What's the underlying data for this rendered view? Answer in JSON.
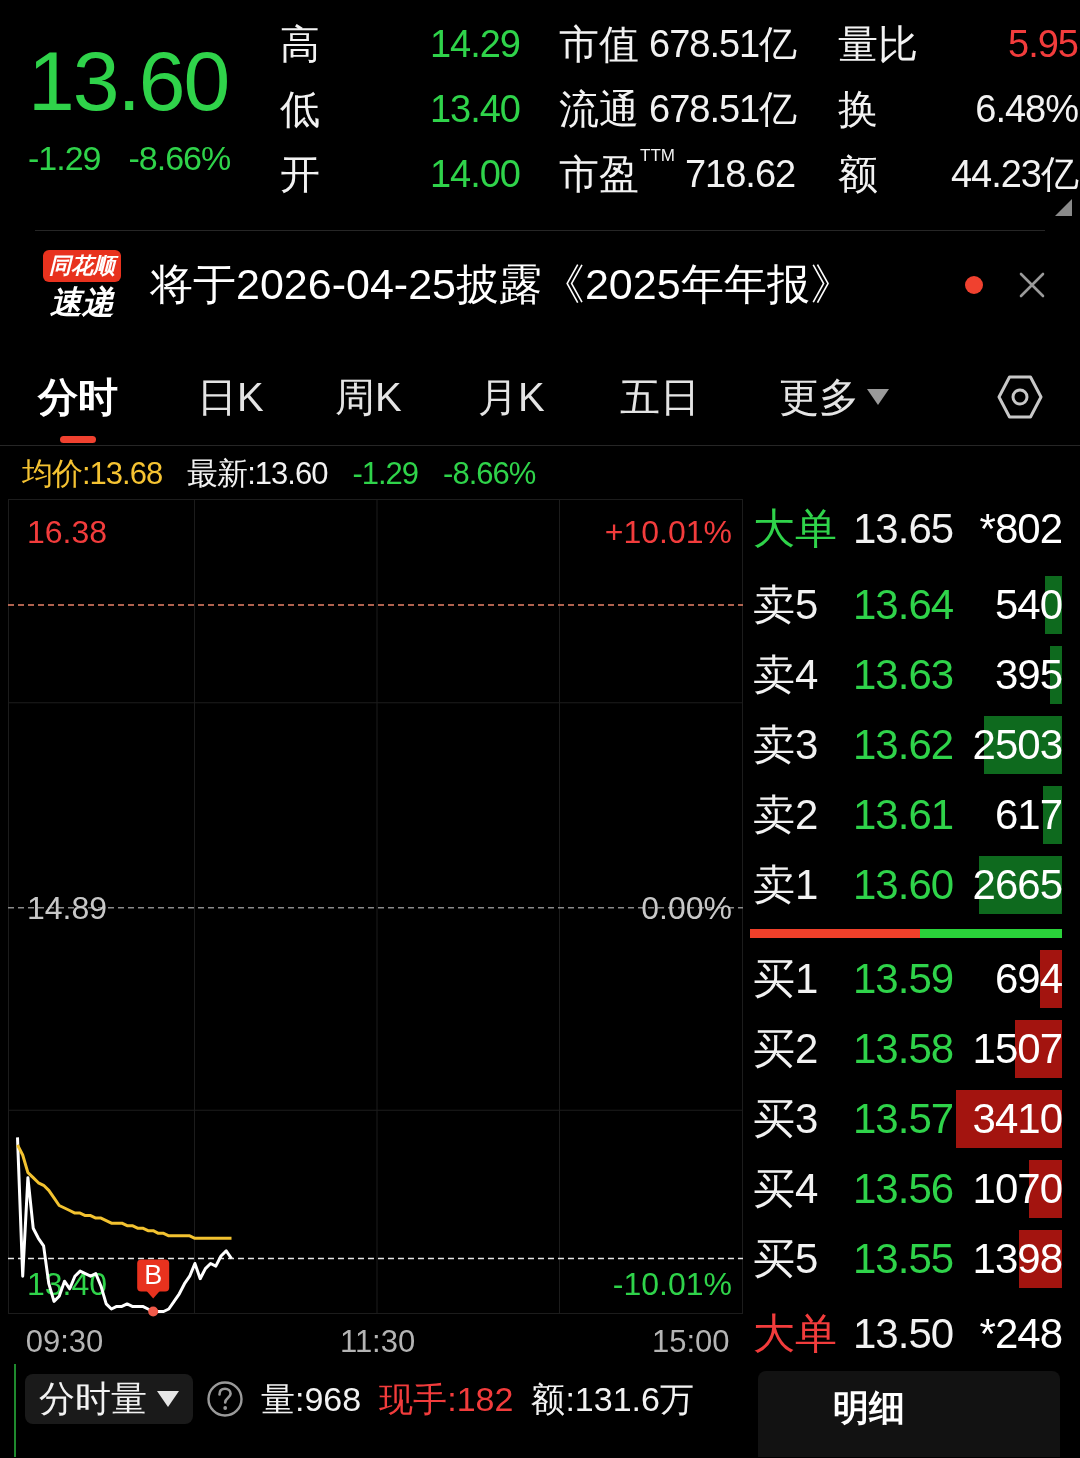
{
  "quote": {
    "price": "13.60",
    "change": "-1.29",
    "change_pct": "-8.66%",
    "stats": [
      [
        {
          "label": "高",
          "value": "14.29",
          "color": "#2fd34a"
        },
        {
          "label": "低",
          "value": "13.40",
          "color": "#2fd34a"
        },
        {
          "label": "开",
          "value": "14.00",
          "color": "#2fd34a"
        }
      ],
      [
        {
          "label": "市值",
          "value": "678.51亿",
          "color": "#f2f2f2"
        },
        {
          "label": "流通",
          "value": "678.51亿",
          "color": "#f2f2f2"
        },
        {
          "label": "市盈$^{TTM}$",
          "value": "718.62",
          "color": "#f2f2f2"
        }
      ],
      [
        {
          "label": "量比",
          "value": "5.95",
          "color": "#f23c3c"
        },
        {
          "label": "换",
          "value": "6.48%",
          "color": "#f2f2f2"
        },
        {
          "label": "额",
          "value": "44.23亿",
          "color": "#f2f2f2"
        }
      ]
    ]
  },
  "news": {
    "logo_top": "同花顺",
    "logo_bottom": "速递",
    "headline": "将于2026-04-25披露《2025年年报》",
    "unread": true
  },
  "tabs": [
    {
      "label": "分时",
      "selected": true,
      "kind": "tab"
    },
    {
      "label": "日K",
      "selected": false,
      "kind": "tab"
    },
    {
      "label": "周K",
      "selected": false,
      "kind": "tab"
    },
    {
      "label": "月K",
      "selected": false,
      "kind": "tab"
    },
    {
      "label": "五日",
      "selected": false,
      "kind": "tab"
    },
    {
      "label": "更多",
      "selected": false,
      "kind": "menu"
    }
  ],
  "summary": {
    "average": "均价:13.68",
    "latest": "最新:13.60",
    "change": "-1.29",
    "change_pct": "-8.66%"
  },
  "chart": {
    "chart_data": {
      "type": "line",
      "categories": [
        null,
        null,
        null,
        null,
        null,
        null,
        null,
        null,
        null,
        "09:30",
        null,
        null,
        null,
        null,
        null,
        null,
        null,
        null,
        null,
        null,
        null,
        null,
        null,
        null,
        null,
        null,
        null,
        null,
        null,
        null,
        null,
        null,
        null,
        null,
        null,
        null,
        null,
        null,
        null,
        null,
        null,
        null,
        null,
        null,
        null,
        null,
        null,
        null,
        null,
        null,
        null,
        null,
        null,
        null,
        null,
        null,
        null,
        null,
        null,
        null,
        null,
        null,
        null,
        null,
        null,
        null,
        null,
        null,
        null,
        "11:30",
        null,
        null,
        null,
        null,
        null,
        null,
        null,
        null,
        null,
        null,
        null,
        null,
        null,
        null,
        null,
        null,
        null,
        null,
        null,
        null,
        null,
        null,
        null,
        null,
        null,
        null,
        null,
        null,
        null,
        null,
        null,
        null,
        null,
        null,
        null,
        null,
        null,
        null,
        null,
        null,
        null,
        null,
        null,
        null,
        null,
        null,
        null,
        null,
        null,
        null,
        null,
        null,
        null,
        null,
        null,
        null,
        null,
        null,
        null,
        "15:00"
      ],
      "series": [
        {
          "color": "#ffffff",
          "values": [
            13.98,
            13.43,
            13.82,
            13.62,
            13.58,
            13.55,
            13.4,
            13.33,
            13.35,
            13.41,
            13.38,
            13.43,
            13.45,
            13.44,
            13.43,
            13.44,
            13.39,
            13.32,
            13.3,
            13.31,
            13.31,
            13.32,
            13.31,
            13.31,
            13.31,
            13.3,
            13.29,
            13.29,
            13.29,
            13.3,
            13.33,
            13.36,
            13.4,
            13.43,
            13.48,
            13.42,
            13.46,
            13.48,
            13.47,
            13.51,
            13.53,
            13.5,
            null,
            null,
            null,
            null,
            null,
            null,
            null,
            null,
            null,
            null,
            null,
            null,
            null,
            null,
            null,
            null,
            null,
            null,
            null,
            null,
            null,
            null,
            null,
            null,
            null,
            null,
            null,
            null,
            null,
            null,
            null,
            null,
            null,
            null,
            null,
            null,
            null,
            null,
            null,
            null,
            null,
            null,
            null,
            null,
            null,
            null,
            null,
            null,
            null,
            null,
            null,
            null,
            null,
            null,
            null,
            null,
            null,
            null,
            null,
            null,
            null,
            null,
            null,
            null,
            null,
            null,
            null,
            null,
            null,
            null,
            null,
            null,
            null,
            null,
            null,
            null,
            null,
            null,
            null,
            null,
            null,
            null,
            null,
            null,
            null,
            null,
            null,
            null
          ]
        },
        {
          "color": "#f2c230",
          "values": [
            13.95,
            13.91,
            13.84,
            13.82,
            13.8,
            13.79,
            13.77,
            13.74,
            13.71,
            13.7,
            13.69,
            13.68,
            13.68,
            13.67,
            13.67,
            13.66,
            13.66,
            13.65,
            13.64,
            13.64,
            13.64,
            13.63,
            13.63,
            13.62,
            13.62,
            13.61,
            13.61,
            13.6,
            13.6,
            13.59,
            13.59,
            13.59,
            13.59,
            13.59,
            13.58,
            13.58,
            13.58,
            13.58,
            13.58,
            13.58,
            13.58,
            13.58,
            null,
            null,
            null,
            null,
            null,
            null,
            null,
            null,
            null,
            null,
            null,
            null,
            null,
            null,
            null,
            null,
            null,
            null,
            null,
            null,
            null,
            null,
            null,
            null,
            null,
            null,
            null,
            null,
            null,
            null,
            null,
            null,
            null,
            null,
            null,
            null,
            null,
            null,
            null,
            null,
            null,
            null,
            null,
            null,
            null,
            null,
            null,
            null,
            null,
            null,
            null,
            null,
            null,
            null,
            null,
            null,
            null,
            null,
            null,
            null,
            null,
            null,
            null,
            null,
            null,
            null,
            null,
            null,
            null,
            null,
            null,
            null,
            null,
            null,
            null,
            null,
            null,
            null,
            null,
            null,
            null,
            null,
            null,
            null,
            null,
            null,
            null,
            null
          ]
        }
      ],
      "ylim": [
        13.28,
        16.51
      ],
      "yticks": [
        {
          "value": 16.38,
          "label": "16.38"
        },
        {
          "value": 14.89,
          "label": "14.89"
        },
        {
          "value": 13.4,
          "label": "13.40"
        }
      ],
      "ref_lines": [
        {
          "axis": "y",
          "value": 16.09,
          "color": "#e8826a"
        },
        {
          "axis": "y",
          "value": 14.89,
          "color": "#8a8a8a"
        },
        {
          "axis": "y",
          "value": 13.5,
          "color": "#e6e6e6"
        }
      ],
      "annotations": [
        "B"
      ]
    },
    "pct_labels": [
      "+10.01%",
      "0.00%",
      "-10.01%"
    ]
  },
  "order_book": {
    "big_top": {
      "label": "大单",
      "price": "13.65",
      "volume": "*802"
    },
    "asks": [
      {
        "label": "卖5",
        "price": "13.64",
        "volume": "540"
      },
      {
        "label": "卖4",
        "price": "13.63",
        "volume": "395"
      },
      {
        "label": "卖3",
        "price": "13.62",
        "volume": "2503"
      },
      {
        "label": "卖2",
        "price": "13.61",
        "volume": "617"
      },
      {
        "label": "卖1",
        "price": "13.60",
        "volume": "2665"
      }
    ],
    "ratio": {
      "level": 0.546
    },
    "bids": [
      {
        "label": "买1",
        "price": "13.59",
        "volume": "694"
      },
      {
        "label": "买2",
        "price": "13.58",
        "volume": "1507"
      },
      {
        "label": "买3",
        "price": "13.57",
        "volume": "3410"
      },
      {
        "label": "买4",
        "price": "13.56",
        "volume": "1070"
      },
      {
        "label": "买5",
        "price": "13.55",
        "volume": "1398"
      }
    ],
    "big_bottom": {
      "label": "大单",
      "price": "13.50",
      "volume": "*248"
    }
  },
  "volume_bar": {
    "selector": "分时量",
    "volume": "量:968",
    "last_trade": "现手:182",
    "amount": "额:131.6万"
  },
  "detail_tab": {
    "label": "明细"
  }
}
